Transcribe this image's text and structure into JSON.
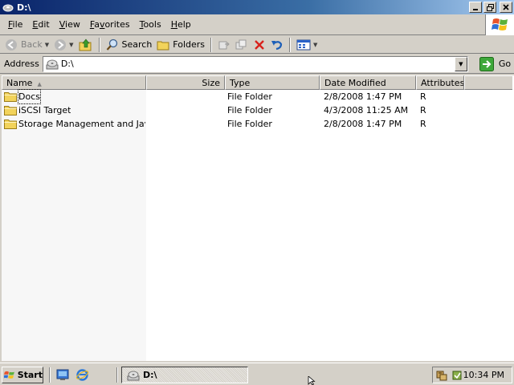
{
  "window": {
    "title": "D:\\"
  },
  "menu": [
    {
      "key": "F",
      "rest": "ile"
    },
    {
      "key": "E",
      "rest": "dit"
    },
    {
      "key": "V",
      "rest": "iew"
    },
    {
      "key": "F",
      "rest": "avorites",
      "prefix": ""
    },
    {
      "key": "T",
      "rest": "ools"
    },
    {
      "key": "H",
      "rest": "elp"
    }
  ],
  "toolbar": {
    "back_label": "Back",
    "search_label": "Search",
    "folders_label": "Folders"
  },
  "address": {
    "label": "Address",
    "value": "D:\\",
    "go_label": "Go"
  },
  "columns": [
    {
      "label": "Name",
      "sorted": true
    },
    {
      "label": "Size"
    },
    {
      "label": "Type"
    },
    {
      "label": "Date Modified"
    },
    {
      "label": "Attributes"
    }
  ],
  "files": [
    {
      "name": "Docs",
      "size": "",
      "type": "File Folder",
      "modified": "2/8/2008 1:47 PM",
      "attributes": "R",
      "focused": true
    },
    {
      "name": "iSCSI Target",
      "size": "",
      "type": "File Folder",
      "modified": "4/3/2008 11:25 AM",
      "attributes": "R"
    },
    {
      "name": "Storage Management and Jav...",
      "size": "",
      "type": "File Folder",
      "modified": "2/8/2008 1:47 PM",
      "attributes": "R"
    }
  ],
  "taskbar": {
    "start_label": "Start",
    "task_label": "D:\\",
    "clock": "10:34 PM"
  },
  "colors": {
    "title_gradient_start": "#0a246a",
    "title_gradient_end": "#a6caf0",
    "face": "#d4d0c8",
    "folder": "#f2d35b"
  }
}
